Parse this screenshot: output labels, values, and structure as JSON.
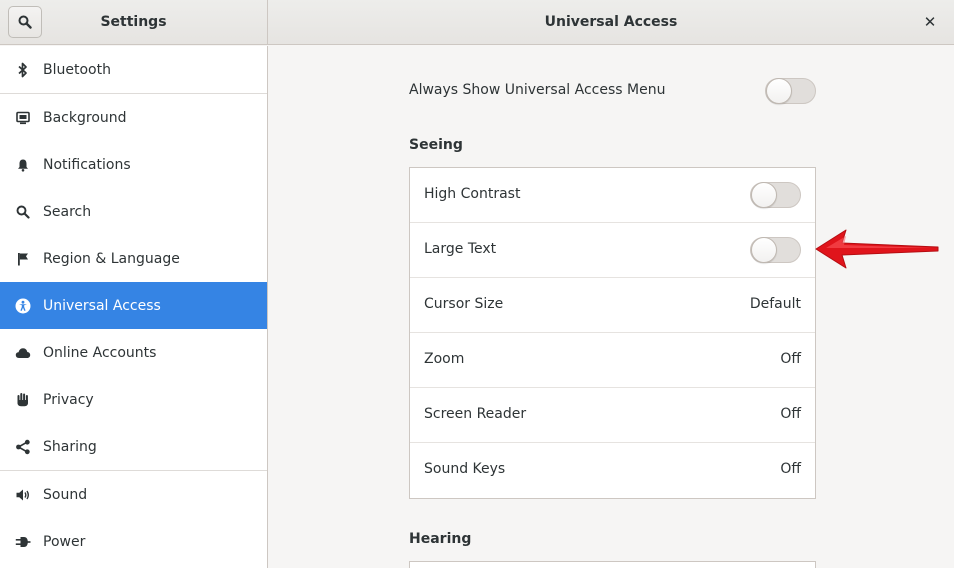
{
  "header": {
    "left_title": "Settings",
    "right_title": "Universal Access",
    "close_glyph": "✕"
  },
  "sidebar": {
    "items": [
      {
        "label": "Bluetooth",
        "icon": "bluetooth-icon"
      },
      {
        "label": "Background",
        "icon": "background-icon"
      },
      {
        "label": "Notifications",
        "icon": "bell-icon"
      },
      {
        "label": "Search",
        "icon": "search-icon"
      },
      {
        "label": "Region & Language",
        "icon": "flag-icon"
      },
      {
        "label": "Universal Access",
        "icon": "accessibility-icon",
        "selected": true
      },
      {
        "label": "Online Accounts",
        "icon": "cloud-icon"
      },
      {
        "label": "Privacy",
        "icon": "hand-icon"
      },
      {
        "label": "Sharing",
        "icon": "share-icon"
      },
      {
        "label": "Sound",
        "icon": "speaker-icon"
      },
      {
        "label": "Power",
        "icon": "plug-icon"
      }
    ]
  },
  "main": {
    "always_show": {
      "label": "Always Show Universal Access Menu",
      "on": false
    },
    "seeing": {
      "heading": "Seeing",
      "rows": [
        {
          "label": "High Contrast",
          "kind": "switch",
          "on": false
        },
        {
          "label": "Large Text",
          "kind": "switch",
          "on": false
        },
        {
          "label": "Cursor Size",
          "kind": "value",
          "value": "Default"
        },
        {
          "label": "Zoom",
          "kind": "value",
          "value": "Off"
        },
        {
          "label": "Screen Reader",
          "kind": "value",
          "value": "Off"
        },
        {
          "label": "Sound Keys",
          "kind": "value",
          "value": "Off"
        }
      ]
    },
    "hearing": {
      "heading": "Hearing"
    }
  },
  "colors": {
    "accent": "#3584e4",
    "annotation_arrow": "#e0141b"
  }
}
